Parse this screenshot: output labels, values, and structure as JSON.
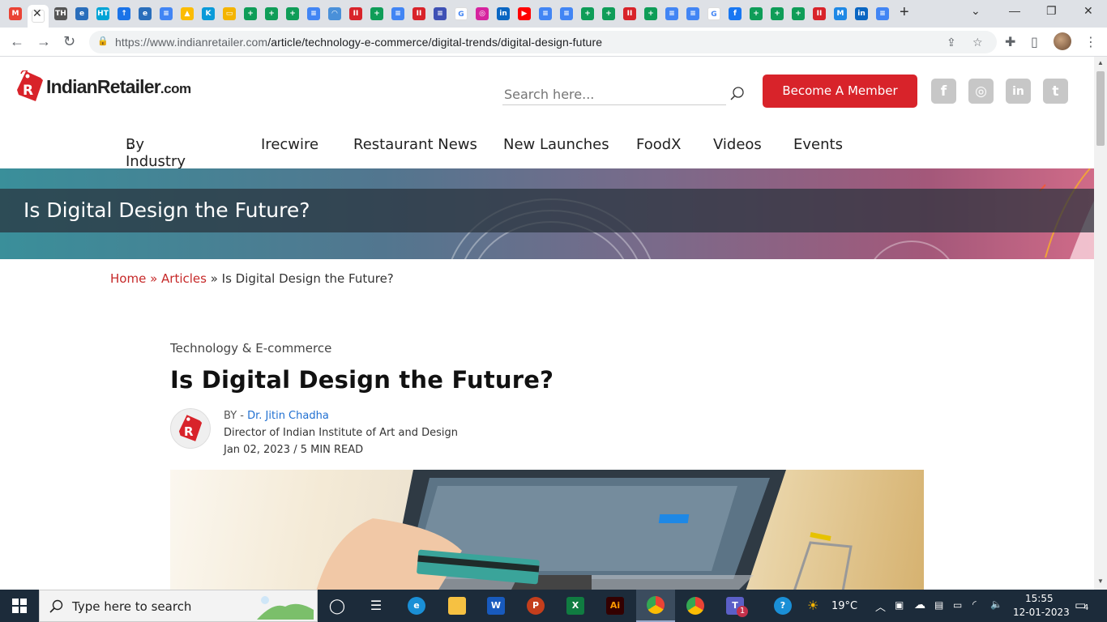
{
  "browser": {
    "url_host": "https://www.indianretailer.com",
    "url_path": "/article/technology-e-commerce/digital-trends/digital-design-future",
    "new_tab": "+",
    "tabs": [
      {
        "icon": "gmail-icon",
        "color": "#ea4335",
        "glyph": "M"
      },
      {
        "icon": "active-tab-favicon",
        "color": "#ffffff",
        "glyph": ""
      },
      {
        "icon": "the-hindu-icon",
        "color": "#555555",
        "glyph": "TH"
      },
      {
        "icon": "edu-icon",
        "color": "#2a6ebb",
        "glyph": "e"
      },
      {
        "icon": "ht-icon",
        "color": "#00a4d6",
        "glyph": "HT"
      },
      {
        "icon": "bookmark-icon",
        "color": "#1a73e8",
        "glyph": "↑"
      },
      {
        "icon": "edu-icon",
        "color": "#2a6ebb",
        "glyph": "e"
      },
      {
        "icon": "google-docs-icon",
        "color": "#4285f4",
        "glyph": "≡"
      },
      {
        "icon": "google-drive-icon",
        "color": "#fbbc04",
        "glyph": "▲"
      },
      {
        "icon": "k-icon",
        "color": "#0a9ad9",
        "glyph": "K"
      },
      {
        "icon": "google-slides-icon",
        "color": "#f4b400",
        "glyph": "▭"
      },
      {
        "icon": "google-sheets-icon",
        "color": "#0f9d58",
        "glyph": "+"
      },
      {
        "icon": "google-sheets-icon",
        "color": "#0f9d58",
        "glyph": "+"
      },
      {
        "icon": "google-sheets-icon",
        "color": "#0f9d58",
        "glyph": "+"
      },
      {
        "icon": "google-docs-icon",
        "color": "#4285f4",
        "glyph": "≡"
      },
      {
        "icon": "arc-icon",
        "color": "#4a90d9",
        "glyph": "◠"
      },
      {
        "icon": "iiad-icon",
        "color": "#d8232a",
        "glyph": "II"
      },
      {
        "icon": "google-sheets-icon",
        "color": "#0f9d58",
        "glyph": "+"
      },
      {
        "icon": "google-docs-icon",
        "color": "#4285f4",
        "glyph": "≡"
      },
      {
        "icon": "iiad-icon",
        "color": "#d8232a",
        "glyph": "II"
      },
      {
        "icon": "stack-icon",
        "color": "#3f51b5",
        "glyph": "≡"
      },
      {
        "icon": "google-icon",
        "color": "#ffffff",
        "glyph": "G"
      },
      {
        "icon": "instagram-icon",
        "color": "#d6249f",
        "glyph": "◎"
      },
      {
        "icon": "linkedin-icon",
        "color": "#0a66c2",
        "glyph": "in"
      },
      {
        "icon": "youtube-icon",
        "color": "#ff0000",
        "glyph": "▶"
      },
      {
        "icon": "google-docs-icon",
        "color": "#4285f4",
        "glyph": "≡"
      },
      {
        "icon": "google-docs-icon",
        "color": "#4285f4",
        "glyph": "≡"
      },
      {
        "icon": "google-sheets-icon",
        "color": "#0f9d58",
        "glyph": "+"
      },
      {
        "icon": "google-sheets-icon",
        "color": "#0f9d58",
        "glyph": "+"
      },
      {
        "icon": "iiad-icon",
        "color": "#d8232a",
        "glyph": "II"
      },
      {
        "icon": "google-sheets-icon",
        "color": "#0f9d58",
        "glyph": "+"
      },
      {
        "icon": "google-docs-icon",
        "color": "#4285f4",
        "glyph": "≡"
      },
      {
        "icon": "google-docs-icon",
        "color": "#4285f4",
        "glyph": "≡"
      },
      {
        "icon": "google-icon",
        "color": "#ffffff",
        "glyph": "G"
      },
      {
        "icon": "facebook-icon",
        "color": "#1877f2",
        "glyph": "f"
      },
      {
        "icon": "google-sheets-icon",
        "color": "#0f9d58",
        "glyph": "+"
      },
      {
        "icon": "google-sheets-icon",
        "color": "#0f9d58",
        "glyph": "+"
      },
      {
        "icon": "google-sheets-icon",
        "color": "#0f9d58",
        "glyph": "+"
      },
      {
        "icon": "iiad-icon",
        "color": "#d8232a",
        "glyph": "II"
      },
      {
        "icon": "m-icon",
        "color": "#1e88e5",
        "glyph": "M"
      },
      {
        "icon": "linkedin-icon",
        "color": "#0a66c2",
        "glyph": "in"
      },
      {
        "icon": "google-docs-icon",
        "color": "#4285f4",
        "glyph": "≡"
      }
    ]
  },
  "site": {
    "logo_word": "IndianRetailer",
    "logo_suffix": ".com",
    "search_placeholder": "Search here...",
    "member_button": "Become A Member",
    "brand_color": "#d8232a",
    "social": [
      {
        "name": "facebook-icon",
        "glyph": "f"
      },
      {
        "name": "instagram-icon",
        "glyph": "◎"
      },
      {
        "name": "linkedin-icon",
        "glyph": "in"
      },
      {
        "name": "twitter-icon",
        "glyph": "t"
      }
    ],
    "nav": [
      "By Industry",
      "Irecwire",
      "Restaurant News",
      "New Launches",
      "FoodX",
      "Videos",
      "Events"
    ]
  },
  "banner": {
    "title": "Is Digital Design the Future?"
  },
  "breadcrumb": {
    "home": "Home",
    "sep1": " » ",
    "articles": "Articles",
    "sep2": " » ",
    "current": "Is Digital Design the Future?"
  },
  "article": {
    "category": "Technology & E-commerce",
    "title": "Is Digital Design the Future?",
    "by_label": "BY - ",
    "author": "Dr. Jitin Chadha",
    "author_role": "Director of Indian Institute of Art and Design",
    "date": "Jan 02, 2023",
    "date_sep": " / ",
    "read_time": "5 MIN READ"
  },
  "taskbar": {
    "search_placeholder": "Type here to search",
    "weather": "19°C",
    "time": "15:55",
    "date": "12-01-2023",
    "notifications": "4",
    "teams_badge": "1"
  }
}
